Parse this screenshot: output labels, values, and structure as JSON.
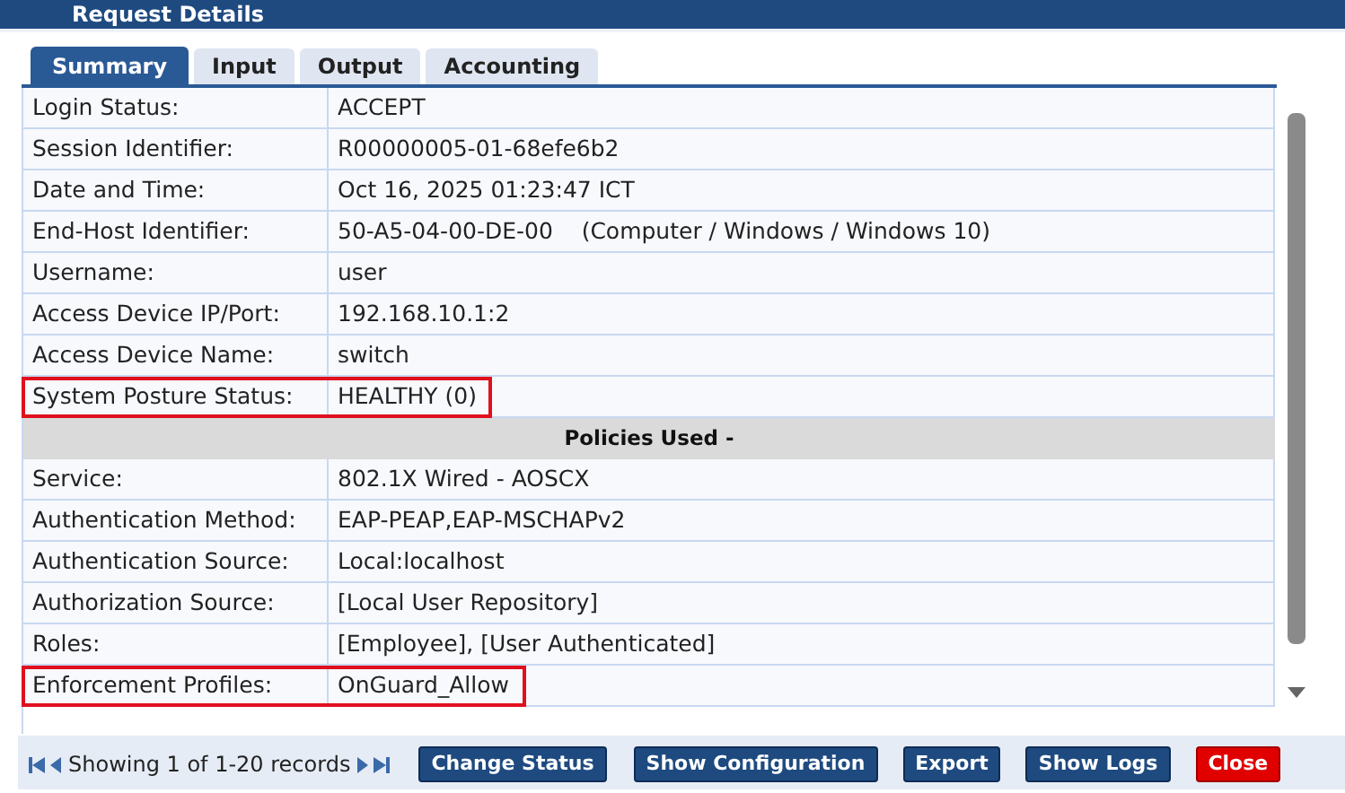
{
  "window": {
    "title": "Request Details"
  },
  "tabs": [
    {
      "label": "Summary",
      "selected": true
    },
    {
      "label": "Input",
      "selected": false
    },
    {
      "label": "Output",
      "selected": false
    },
    {
      "label": "Accounting",
      "selected": false
    }
  ],
  "rows": [
    {
      "kind": "field",
      "label": "Login Status:",
      "value": "ACCEPT",
      "highlighted": false
    },
    {
      "kind": "field",
      "label": "Session Identifier:",
      "value": "R00000005-01-68efe6b2",
      "highlighted": false
    },
    {
      "kind": "field",
      "label": "Date and Time:",
      "value": "Oct 16, 2025 01:23:47 ICT",
      "highlighted": false
    },
    {
      "kind": "field",
      "label": "End-Host Identifier:",
      "value": "50-A5-04-00-DE-00    (Computer / Windows / Windows 10)",
      "highlighted": false
    },
    {
      "kind": "field",
      "label": "Username:",
      "value": "user",
      "highlighted": false
    },
    {
      "kind": "field",
      "label": "Access Device IP/Port:",
      "value": "192.168.10.1:2",
      "highlighted": false
    },
    {
      "kind": "field",
      "label": "Access Device Name:",
      "value": "switch",
      "highlighted": false
    },
    {
      "kind": "field",
      "label": "System Posture Status:",
      "value": "HEALTHY (0)",
      "highlighted": true
    },
    {
      "kind": "section",
      "label": "Policies Used -"
    },
    {
      "kind": "field",
      "label": "Service:",
      "value": "802.1X Wired - AOSCX",
      "highlighted": false
    },
    {
      "kind": "field",
      "label": "Authentication Method:",
      "value": "EAP-PEAP,EAP-MSCHAPv2",
      "highlighted": false
    },
    {
      "kind": "field",
      "label": "Authentication Source:",
      "value": "Local:localhost",
      "highlighted": false
    },
    {
      "kind": "field",
      "label": "Authorization Source:",
      "value": "[Local User Repository]",
      "highlighted": false
    },
    {
      "kind": "field",
      "label": "Roles:",
      "value": "[Employee], [User Authenticated]",
      "highlighted": false
    },
    {
      "kind": "field",
      "label": "Enforcement Profiles:",
      "value": "OnGuard_Allow",
      "highlighted": true
    }
  ],
  "footer": {
    "pager_text": "Showing 1 of 1-20 records",
    "buttons": [
      {
        "label": "Change Status",
        "kind": "normal"
      },
      {
        "label": "Show Configuration",
        "kind": "normal"
      },
      {
        "label": "Export",
        "kind": "normal"
      },
      {
        "label": "Show Logs",
        "kind": "normal"
      },
      {
        "label": "Close",
        "kind": "danger"
      }
    ]
  }
}
